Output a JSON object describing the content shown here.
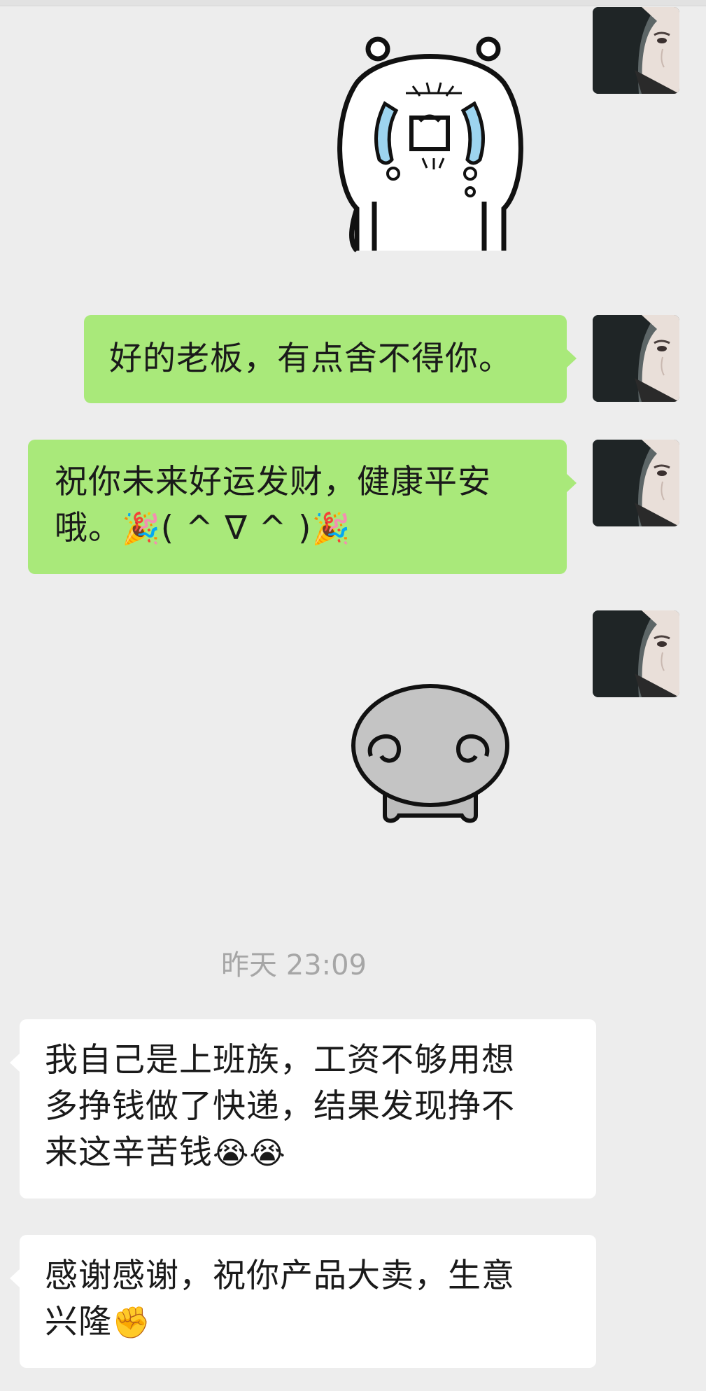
{
  "chat": {
    "messages": [
      {
        "id": "m1",
        "sender": "me",
        "type": "sticker",
        "sticker": "crying-bear-sticker"
      },
      {
        "id": "m2",
        "sender": "me",
        "type": "text",
        "text": "好的老板，有点舍不得你。"
      },
      {
        "id": "m3",
        "sender": "me",
        "type": "text",
        "text_line1": "祝你未来好运发财，健康平安",
        "text_line2_prefix": "哦。",
        "emoji_party": "🎉",
        "kaomoji": "( ^ ∇ ^ )"
      },
      {
        "id": "m4",
        "sender": "me",
        "type": "sticker",
        "sticker": "grey-blob-crying-sticker"
      },
      {
        "id": "m5",
        "sender": "other",
        "type": "text",
        "text_line1": "我自己是上班族，工资不够用想",
        "text_line2": "多挣钱做了快递，结果发现挣不",
        "text_line3_prefix": "来这辛苦钱",
        "emoji_laugh_cry": "😭😭"
      },
      {
        "id": "m6",
        "sender": "other",
        "type": "text",
        "text_line1": "感谢感谢，祝你产品大卖，生意",
        "text_line2_prefix": "兴隆",
        "emoji_fist": "✊"
      }
    ],
    "timestamp": "昨天 23:09"
  },
  "colors": {
    "background": "#ededed",
    "my_bubble": "#a9e97a",
    "other_bubble": "#ffffff",
    "timestamp_text": "#a6a6a6"
  }
}
